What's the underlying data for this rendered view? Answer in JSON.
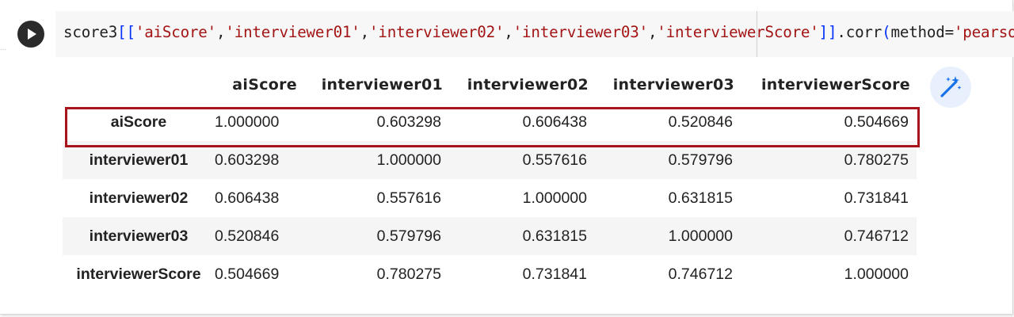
{
  "code_cell": {
    "tokens": [
      {
        "t": "score3",
        "c": "plain"
      },
      {
        "t": "[[",
        "c": "bracket"
      },
      {
        "t": "'aiScore'",
        "c": "str"
      },
      {
        "t": ",",
        "c": "plain"
      },
      {
        "t": "'interviewer01'",
        "c": "str"
      },
      {
        "t": ",",
        "c": "plain"
      },
      {
        "t": "'interviewer02'",
        "c": "str"
      },
      {
        "t": ",",
        "c": "plain"
      },
      {
        "t": "'interviewer03'",
        "c": "str"
      },
      {
        "t": ",",
        "c": "plain"
      },
      {
        "t": "'interviewerScore'",
        "c": "str"
      },
      {
        "t": "]]",
        "c": "bracket"
      },
      {
        "t": ".corr",
        "c": "plain"
      },
      {
        "t": "(",
        "c": "paren"
      },
      {
        "t": "method=",
        "c": "plain"
      },
      {
        "t": "'pearson'",
        "c": "str"
      },
      {
        "t": ")",
        "c": "paren"
      }
    ],
    "gutter_mark": "..."
  },
  "table": {
    "columns": [
      "aiScore",
      "interviewer01",
      "interviewer02",
      "interviewer03",
      "interviewerScore"
    ],
    "rows": [
      {
        "index": "aiScore",
        "values": [
          "1.000000",
          "0.603298",
          "0.606438",
          "0.520846",
          "0.504669"
        ],
        "highlighted": true
      },
      {
        "index": "interviewer01",
        "values": [
          "0.603298",
          "1.000000",
          "0.557616",
          "0.579796",
          "0.780275"
        ],
        "highlighted": false
      },
      {
        "index": "interviewer02",
        "values": [
          "0.606438",
          "0.557616",
          "1.000000",
          "0.631815",
          "0.731841"
        ],
        "highlighted": false
      },
      {
        "index": "interviewer03",
        "values": [
          "0.520846",
          "0.579796",
          "0.631815",
          "1.000000",
          "0.746712"
        ],
        "highlighted": false
      },
      {
        "index": "interviewerScore",
        "values": [
          "0.504669",
          "0.780275",
          "0.731841",
          "0.746712",
          "1.000000"
        ],
        "highlighted": false
      }
    ]
  },
  "icons": {
    "run": "play-icon",
    "magic": "magic-wand-icon"
  },
  "colors": {
    "string": "#a31515",
    "bracket": "#0431fa",
    "highlight_border": "#a8141a",
    "magic_icon": "#1a73e8"
  }
}
